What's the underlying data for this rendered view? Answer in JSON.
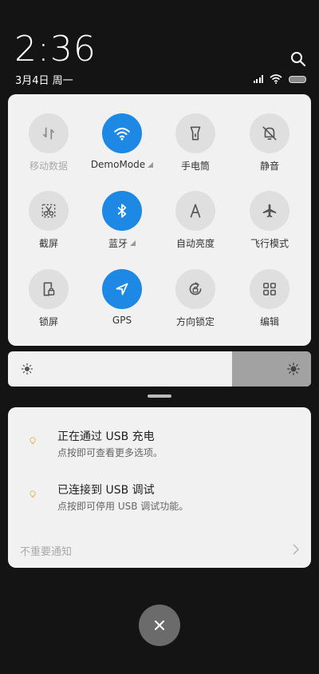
{
  "status": {
    "time": "2:36",
    "date": "3月4日 周一"
  },
  "tiles": [
    {
      "id": "mobile-data",
      "label": "移动数据",
      "icon": "mobile-data-icon",
      "active": false,
      "disabled": true,
      "arrow": false
    },
    {
      "id": "wifi",
      "label": "DemoMode",
      "icon": "wifi-icon",
      "active": true,
      "disabled": false,
      "arrow": true
    },
    {
      "id": "flashlight",
      "label": "手电筒",
      "icon": "flashlight-icon",
      "active": false,
      "disabled": false,
      "arrow": false
    },
    {
      "id": "mute",
      "label": "静音",
      "icon": "bell-off-icon",
      "active": false,
      "disabled": false,
      "arrow": false
    },
    {
      "id": "screenshot",
      "label": "截屏",
      "icon": "scissors-icon",
      "active": false,
      "disabled": false,
      "arrow": false
    },
    {
      "id": "bluetooth",
      "label": "蓝牙",
      "icon": "bluetooth-icon",
      "active": true,
      "disabled": false,
      "arrow": true
    },
    {
      "id": "auto-brightness",
      "label": "自动亮度",
      "icon": "auto-brightness-icon",
      "active": false,
      "disabled": false,
      "arrow": false
    },
    {
      "id": "airplane",
      "label": "飞行模式",
      "icon": "airplane-icon",
      "active": false,
      "disabled": false,
      "arrow": false
    },
    {
      "id": "lock-screen",
      "label": "锁屏",
      "icon": "lock-screen-icon",
      "active": false,
      "disabled": false,
      "arrow": false
    },
    {
      "id": "gps",
      "label": "GPS",
      "icon": "location-arrow-icon",
      "active": true,
      "disabled": false,
      "arrow": false
    },
    {
      "id": "rotation-lock",
      "label": "方向锁定",
      "icon": "rotation-lock-icon",
      "active": false,
      "disabled": false,
      "arrow": false
    },
    {
      "id": "edit",
      "label": "编辑",
      "icon": "grid-icon",
      "active": false,
      "disabled": false,
      "arrow": false
    }
  ],
  "brightness": {
    "level": 0.74
  },
  "notifications": [
    {
      "title": "正在通过 USB 充电",
      "subtitle": "点按即可查看更多选项。",
      "icon": "lightbulb-icon"
    },
    {
      "title": "已连接到 USB 调试",
      "subtitle": "点按即可停用 USB 调试功能。",
      "icon": "lightbulb-icon"
    }
  ],
  "unimportant_label": "不重要通知",
  "colors": {
    "accent": "#1e88e5",
    "panel": "#f1f1f1",
    "background": "#141414"
  }
}
